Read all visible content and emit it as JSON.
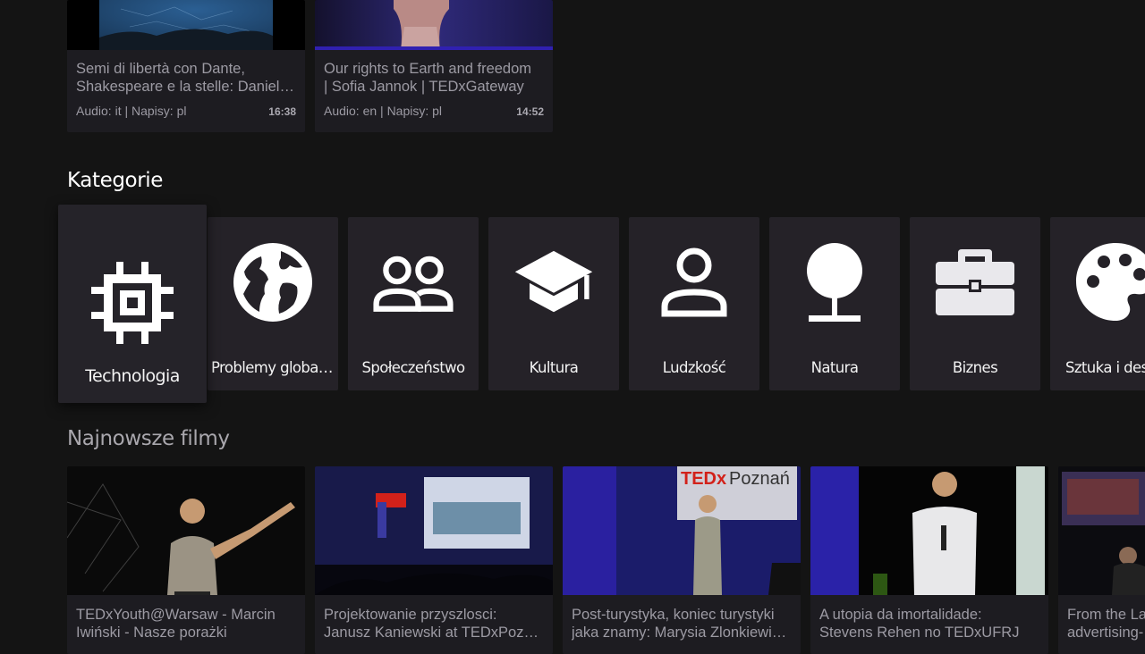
{
  "top_row": {
    "cards": [
      {
        "title_l1": "Semi di libertà con Dante,",
        "title_l2": "Shakespeare e la stelle: Daniel…",
        "meta": "Audio: it | Napisy: pl",
        "duration": "16:38"
      },
      {
        "title_l1": "Our rights to Earth and freedom",
        "title_l2": "| Sofia Jannok | TEDxGateway",
        "meta": "Audio: en | Napisy: pl",
        "duration": "14:52"
      }
    ]
  },
  "categories": {
    "title": "Kategorie",
    "items": [
      {
        "label": "Technologia",
        "icon": "chip-icon"
      },
      {
        "label": "Problemy globalne",
        "icon": "globe-icon"
      },
      {
        "label": "Społeczeństwo",
        "icon": "people-icon"
      },
      {
        "label": "Kultura",
        "icon": "graduation-cap-icon"
      },
      {
        "label": "Ludzkość",
        "icon": "person-icon"
      },
      {
        "label": "Natura",
        "icon": "tree-icon"
      },
      {
        "label": "Biznes",
        "icon": "briefcase-icon"
      },
      {
        "label": "Sztuka i design",
        "icon": "palette-icon"
      }
    ]
  },
  "latest": {
    "title": "Najnowsze filmy",
    "cards": [
      {
        "title_l1": "TEDxYouth@Warsaw - Marcin",
        "title_l2": "Iwiński - Nasze porażki"
      },
      {
        "title_l1": "Projektowanie przyszlosci:",
        "title_l2": "Janusz Kaniewski at TEDxPozn…"
      },
      {
        "title_l1": "Post-turystyka, koniec turystyki",
        "title_l2": "jaka znamy: Marysia Zlonkiewi…"
      },
      {
        "title_l1": "A utopia da imortalidade:",
        "title_l2": "Stevens Rehen no TEDxUFRJ"
      },
      {
        "title_l1": "From the La",
        "title_l2": "advertising-"
      }
    ]
  },
  "colors": {
    "background": "#141414",
    "card": "#1d1c21",
    "category_tile": "#252228",
    "ted_red": "#e62b1e"
  }
}
